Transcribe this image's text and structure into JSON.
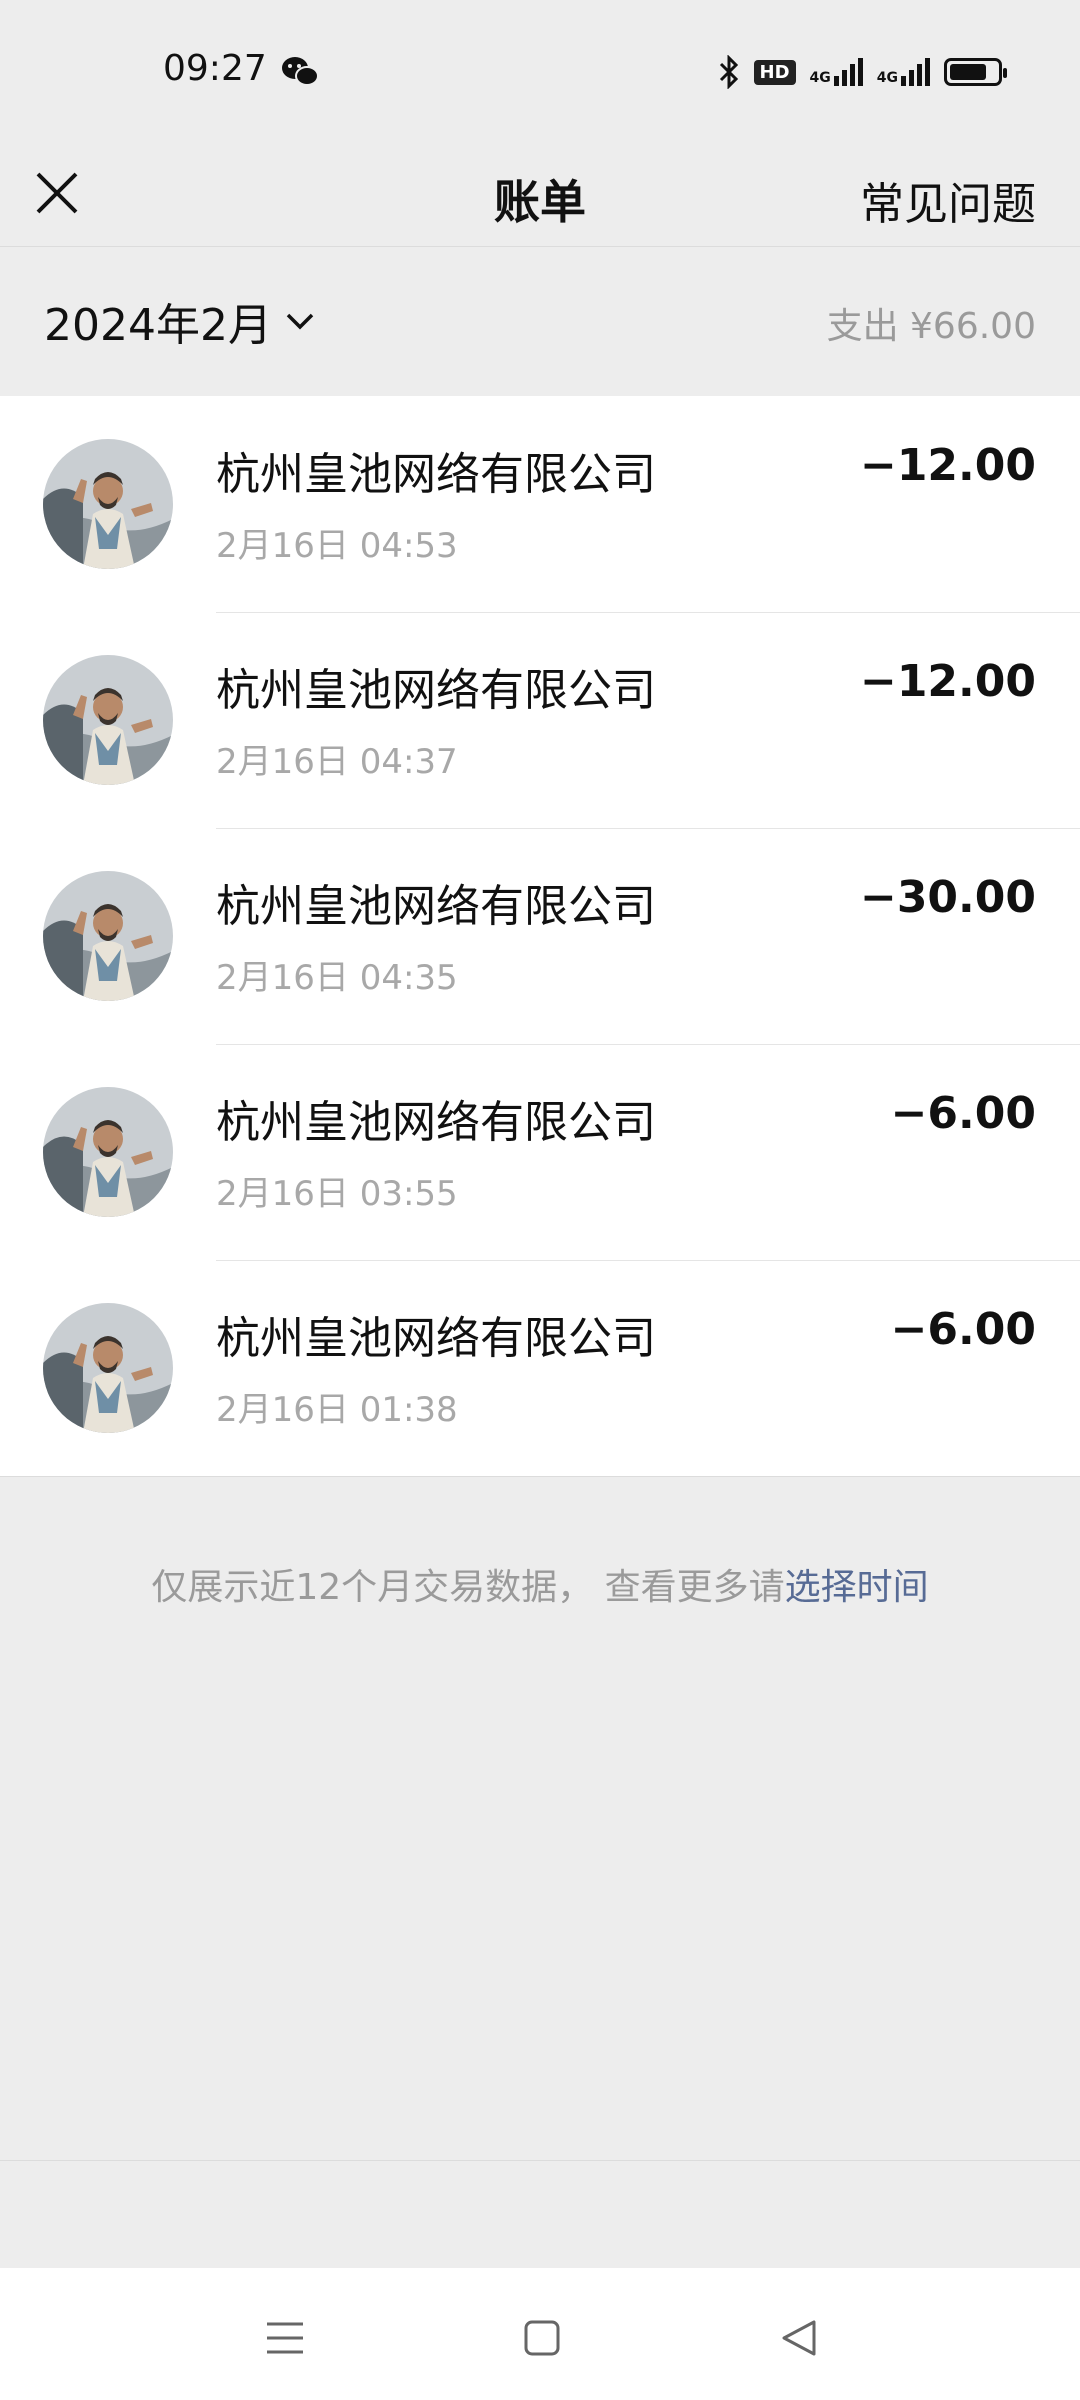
{
  "status_bar": {
    "time": "09:27",
    "hd_label": "HD",
    "net1": "4G",
    "net2": "4G",
    "icons": [
      "wechat-icon",
      "bluetooth-icon",
      "hd-icon",
      "signal-icon",
      "signal-icon",
      "battery-icon"
    ]
  },
  "nav": {
    "title": "账单",
    "faq_label": "常见问题",
    "close_icon": "close-icon"
  },
  "filter": {
    "month": "2024年2月",
    "summary": "支出 ¥66.00"
  },
  "transactions": [
    {
      "merchant": "杭州皇池网络有限公司",
      "time": "2月16日 04:53",
      "amount": "−12.00"
    },
    {
      "merchant": "杭州皇池网络有限公司",
      "time": "2月16日 04:37",
      "amount": "−12.00"
    },
    {
      "merchant": "杭州皇池网络有限公司",
      "time": "2月16日 04:35",
      "amount": "−30.00"
    },
    {
      "merchant": "杭州皇池网络有限公司",
      "time": "2月16日 03:55",
      "amount": "−6.00"
    },
    {
      "merchant": "杭州皇池网络有限公司",
      "time": "2月16日 01:38",
      "amount": "−6.00"
    }
  ],
  "footer": {
    "note": "仅展示近12个月交易数据， 查看更多请",
    "link": "选择时间"
  },
  "colors": {
    "background": "#ededed",
    "card": "#ffffff",
    "link": "#576b95",
    "secondary_text": "#9a9a9a"
  }
}
